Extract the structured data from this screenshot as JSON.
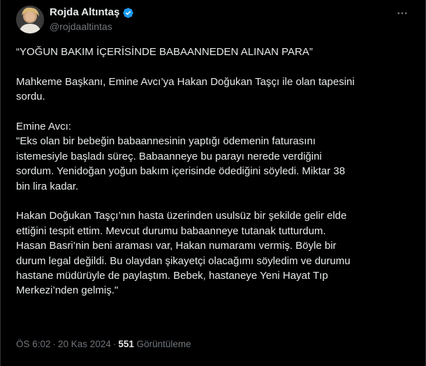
{
  "author": {
    "display_name": "Rojda Altıntaş",
    "handle": "@rojdaaltintas",
    "verified": true,
    "verified_color": "#1d9bf0"
  },
  "tweet": {
    "paragraphs": [
      {
        "lines": [
          "“YOĞUN BAKIM İÇERİSİNDE BABAANNEDEN ALINAN PARA”"
        ]
      },
      {
        "lines": [
          "Mahkeme Başkanı, Emine Avcı’ya Hakan Doğukan Taşçı ile olan tapesini",
          "sordu."
        ]
      },
      {
        "lines": [
          "Emine Avcı:",
          "\"Eks olan bir bebeğin babaannesinin yaptığı ödemenin faturasını",
          "istemesiyle başladı süreç. Babaanneye bu parayı nerede verdiğini",
          "sordum. Yenidoğan yoğun bakım içerisinde ödediğini söyledi. Miktar 38",
          "bin lira kadar."
        ]
      },
      {
        "lines": [
          "Hakan Doğukan Taşçı’nın hasta üzerinden usulsüz bir şekilde gelir elde",
          "ettiğini tespit ettim. Mevcut durumu babaanneye tutanak tutturdum.",
          "Hasan Basri’nin beni araması var, Hakan numaramı vermiş. Böyle bir",
          "durum legal değildi. Bu olaydan şikayetçi olacağımı söyledim ve durumu",
          "hastane müdürüyle de paylaştım. Bebek, hastaneye Yeni Hayat Tıp",
          "Merkezi’nden gelmiş.\""
        ]
      }
    ]
  },
  "meta": {
    "time": "ÖS 6:02",
    "date": "20 Kas 2024",
    "separator": "·",
    "views_count": "551",
    "views_label": "Görüntüleme"
  },
  "colors": {
    "background": "#000000",
    "text_primary": "#e7e9ea",
    "text_secondary": "#71767b"
  },
  "icons": {
    "verified": "verified-badge-icon",
    "more": "more-options-icon"
  }
}
